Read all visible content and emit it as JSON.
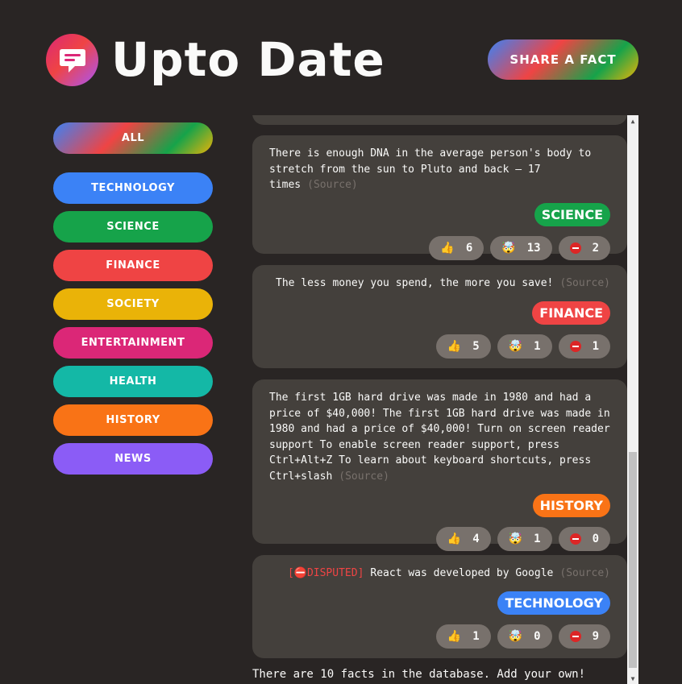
{
  "header": {
    "title": "Upto Date",
    "share_label": "SHARE A FACT"
  },
  "sidebar": {
    "all_label": "ALL",
    "categories": [
      {
        "label": "TECHNOLOGY",
        "color": "#3b82f6"
      },
      {
        "label": "SCIENCE",
        "color": "#16a34a"
      },
      {
        "label": "FINANCE",
        "color": "#ef4444"
      },
      {
        "label": "SOCIETY",
        "color": "#eab308"
      },
      {
        "label": "ENTERTAINMENT",
        "color": "#db2777"
      },
      {
        "label": "HEALTH",
        "color": "#14b8a6"
      },
      {
        "label": "HISTORY",
        "color": "#f97316"
      },
      {
        "label": "NEWS",
        "color": "#8b5cf6"
      }
    ]
  },
  "facts": [
    {
      "text": "There is enough DNA in the average person's body to stretch from the sun to Pluto and back — 17 times",
      "source": "(Source)",
      "category": "SCIENCE",
      "category_color": "#16a34a",
      "votes": {
        "interesting": "6",
        "mindblowing": "13",
        "false": "2"
      }
    },
    {
      "text": "The less money you spend, the more you save!",
      "source": "(Source)",
      "category": "FINANCE",
      "category_color": "#ef4444",
      "votes": {
        "interesting": "5",
        "mindblowing": "1",
        "false": "1"
      }
    },
    {
      "text": "The first 1GB hard drive was made in 1980 and had a price of $40,000! The first 1GB hard drive was made in 1980 and had a price of $40,000! Turn on screen reader support To enable screen reader support, press Ctrl+Alt+Z To learn about keyboard shortcuts, press Ctrl+slash",
      "source": "(Source)",
      "category": "HISTORY",
      "category_color": "#f97316",
      "votes": {
        "interesting": "4",
        "mindblowing": "1",
        "false": "0"
      }
    },
    {
      "disputed": "[⛔DISPUTED]",
      "text": "React was developed by Google",
      "source": "(Source)",
      "category": "TECHNOLOGY",
      "category_color": "#3b82f6",
      "votes": {
        "interesting": "1",
        "mindblowing": "0",
        "false": "9"
      }
    }
  ],
  "footer": {
    "count_text": "There are 10 facts in the database. Add your own!"
  },
  "icons": {
    "interesting": "👍",
    "mindblowing": "🤯"
  }
}
